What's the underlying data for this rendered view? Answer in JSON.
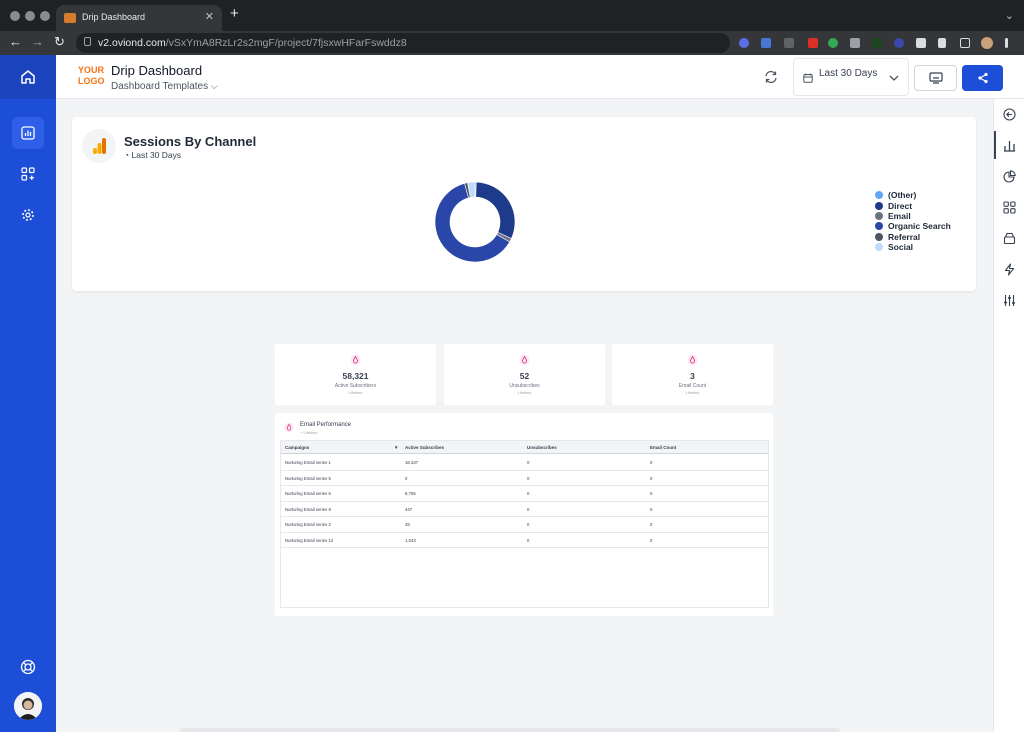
{
  "browser": {
    "tab_title": "Drip Dashboard",
    "url_host": "v2.oviond.com",
    "url_path": "/vSxYmA8RzLr2s2mgF/project/7fjsxwHFarFswddz8"
  },
  "header": {
    "logo_line1": "YOUR",
    "logo_line2": "LOGO",
    "title": "Drip Dashboard",
    "subtitle": "Dashboard Templates",
    "date_range": "Last 30 Days"
  },
  "sessions_card": {
    "title": "Sessions By Channel",
    "subtitle": "Last 30 Days"
  },
  "chart_data": {
    "type": "pie",
    "title": "Sessions By Channel",
    "legend_position": "right",
    "categories": [
      "(Other)",
      "Direct",
      "Email",
      "Organic Search",
      "Referral",
      "Social"
    ],
    "values": [
      0.5,
      31.3,
      1.5,
      62.5,
      1.2,
      3.0
    ],
    "colors": [
      "#60a5fa",
      "#1e3a8a",
      "#6b7280",
      "#2a46a8",
      "#4b5563",
      "#bfdbfe"
    ]
  },
  "stats": [
    {
      "value": "58,321",
      "label": "Active Subscribers",
      "sub": "Lifetime"
    },
    {
      "value": "52",
      "label": "Unsubscribes",
      "sub": "Lifetime"
    },
    {
      "value": "3",
      "label": "Email Count",
      "sub": "Lifetime"
    }
  ],
  "email_table": {
    "title": "Email Performance",
    "subtitle": "Lifetime",
    "columns": [
      "Campaigns",
      "Active Subscribes",
      "Unsubscribes",
      "Email Count"
    ],
    "rows": [
      [
        "Nurturing Email series 1",
        "18,337",
        "0",
        "0"
      ],
      [
        "Nurturing Email series 5",
        "0",
        "0",
        "0"
      ],
      [
        "Nurturing Email series 6",
        "8,755",
        "0",
        "0"
      ],
      [
        "Nurturing Email series 8",
        "447",
        "0",
        "0"
      ],
      [
        "Nurturing Email series 2",
        "45",
        "0",
        "0"
      ],
      [
        "Nurturing Email series 12",
        "1,043",
        "0",
        "0"
      ]
    ]
  }
}
